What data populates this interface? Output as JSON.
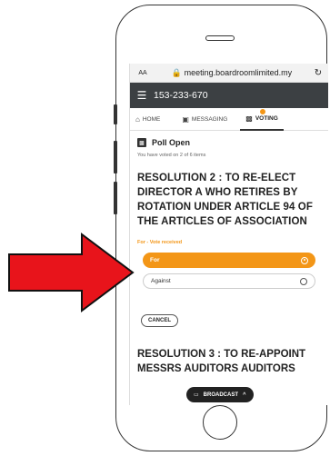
{
  "browser": {
    "text_size": "AA",
    "lock_icon": "lock-icon",
    "url": "meeting.boardroomlimited.my",
    "reload_icon": "reload-icon"
  },
  "appbar": {
    "menu_icon": "hamburger-icon",
    "meeting_id": "153-233-670"
  },
  "tabs": [
    {
      "label": "HOME",
      "icon": "home-icon"
    },
    {
      "label": "MESSAGING",
      "icon": "message-icon"
    },
    {
      "label": "VOTING",
      "icon": "voting-icon",
      "active": true,
      "badge": true
    }
  ],
  "poll": {
    "title": "Poll Open",
    "voted_text": "You have voted on 2 of 6 items",
    "resolution": "RESOLUTION 2 : TO RE-ELECT DIRECTOR A WHO RETIRES BY ROTATION UNDER ARTICLE 94 OF THE ARTICLES OF ASSOCIATION",
    "vote_status": "For - Vote received",
    "options": [
      {
        "label": "For",
        "selected": true
      },
      {
        "label": "Against",
        "selected": false
      }
    ],
    "cancel_label": "CANCEL",
    "next_resolution": "RESOLUTION 3 : TO RE-APPOINT MESSRS AUDITORS AUDITORS"
  },
  "broadcast": {
    "label": "BROADCAST",
    "icon": "cast-icon",
    "chevron": "chevron-up-icon"
  },
  "colors": {
    "accent": "#f39617",
    "appbar": "#3c4043",
    "arrow": "#e8141b"
  }
}
